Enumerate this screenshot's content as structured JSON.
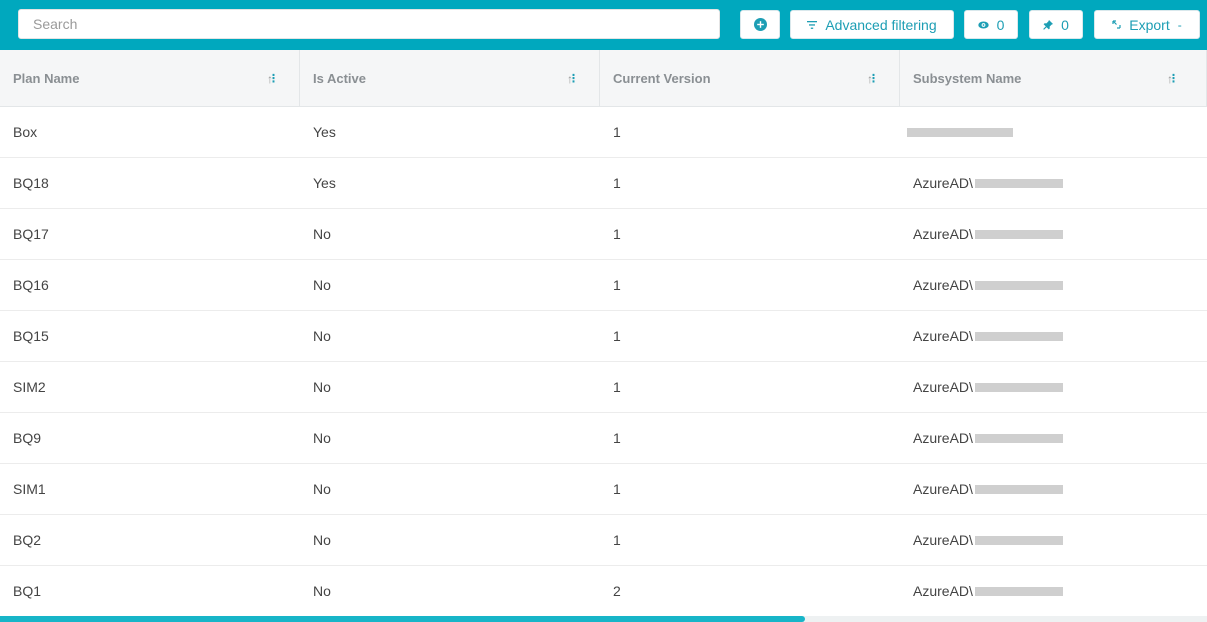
{
  "search": {
    "placeholder": "Search"
  },
  "toolbar": {
    "add_icon": "plus-circle-icon",
    "filter_label": "Advanced filtering",
    "visible_count": "0",
    "pinned_count": "0",
    "export_label": "Export"
  },
  "columns": [
    {
      "label": "Plan Name"
    },
    {
      "label": "Is Active"
    },
    {
      "label": "Current Version"
    },
    {
      "label": "Subsystem Name"
    }
  ],
  "rows": [
    {
      "plan": "Box",
      "active": "Yes",
      "version": "1",
      "subsystem": ""
    },
    {
      "plan": "BQ18",
      "active": "Yes",
      "version": "1",
      "subsystem": "AzureAD\\"
    },
    {
      "plan": "BQ17",
      "active": "No",
      "version": "1",
      "subsystem": "AzureAD\\"
    },
    {
      "plan": "BQ16",
      "active": "No",
      "version": "1",
      "subsystem": "AzureAD\\"
    },
    {
      "plan": "BQ15",
      "active": "No",
      "version": "1",
      "subsystem": "AzureAD\\"
    },
    {
      "plan": "SIM2",
      "active": "No",
      "version": "1",
      "subsystem": "AzureAD\\"
    },
    {
      "plan": "BQ9",
      "active": "No",
      "version": "1",
      "subsystem": "AzureAD\\"
    },
    {
      "plan": "SIM1",
      "active": "No",
      "version": "1",
      "subsystem": "AzureAD\\"
    },
    {
      "plan": "BQ2",
      "active": "No",
      "version": "1",
      "subsystem": "AzureAD\\"
    },
    {
      "plan": "BQ1",
      "active": "No",
      "version": "2",
      "subsystem": "AzureAD\\"
    }
  ],
  "colors": {
    "accent": "#00a8be",
    "link": "#1d9eb4",
    "header_bg": "#f5f6f7"
  }
}
